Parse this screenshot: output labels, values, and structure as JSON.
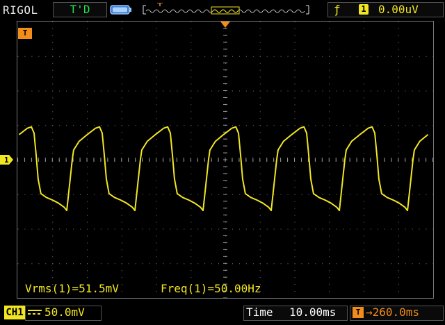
{
  "header": {
    "brand": "RIGOL",
    "trigger_status": "T'D",
    "trigger_level": "0.00uV",
    "trigger_source": "1",
    "trigger_edge_icon": "rising-edge-icon"
  },
  "screen": {
    "channel_marker": "1",
    "trigger_marker": "T",
    "measurements": {
      "vrms": "Vrms(1)=51.5mV",
      "freq": "Freq(1)=50.00Hz"
    }
  },
  "footer": {
    "channel_label": "CH1",
    "channel_scale": "50.0mV",
    "time_label": "Time",
    "timebase": "10.00ms",
    "trigger_position_marker": "T",
    "trigger_position": "→260.0ms"
  },
  "colors": {
    "ch1": "#f2e622",
    "trigger": "#f28c1a",
    "grid": "#7a7a7a",
    "status": "#22e14a"
  }
}
